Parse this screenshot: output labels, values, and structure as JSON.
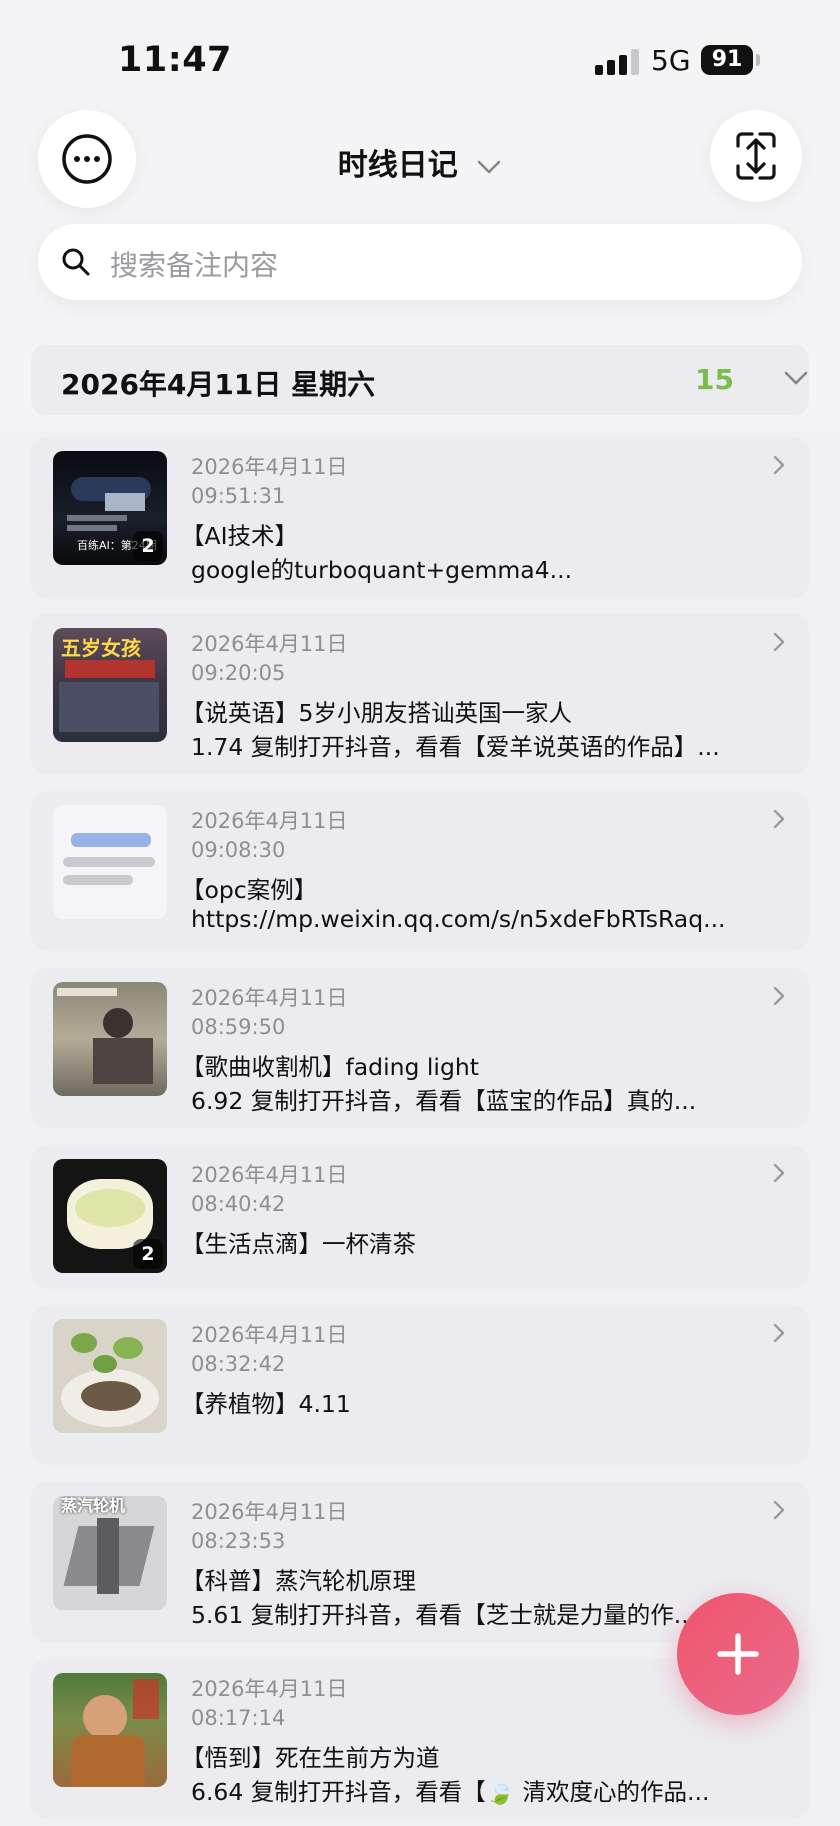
{
  "status_bar": {
    "time": "11:47",
    "network": "5G",
    "battery": "91"
  },
  "header": {
    "title": "时线日记",
    "search_placeholder": "搜索备注内容"
  },
  "date_group": {
    "date": "2026年4月11日 星期六",
    "count": "15"
  },
  "entries": [
    {
      "date": "2026年4月11日",
      "time": "09:51:31",
      "line1": "【AI技术】",
      "line2": "google的turboquant+gemma4...",
      "badge": "2",
      "thumb_caption": "百练AI：第24期"
    },
    {
      "date": "2026年4月11日",
      "time": "09:20:05",
      "line1": "【说英语】5岁小朋友搭讪英国一家人",
      "line2": "1.74 复制打开抖音，看看【爱羊说英语的作品】...",
      "badge": "",
      "thumb_caption": "五岁女孩"
    },
    {
      "date": "2026年4月11日",
      "time": "09:08:30",
      "line1": "【opc案例】",
      "line2": "https://mp.weixin.qq.com/s/n5xdeFbRTsRaq...",
      "badge": "",
      "thumb_caption": ""
    },
    {
      "date": "2026年4月11日",
      "time": "08:59:50",
      "line1": "【歌曲收割机】fading light",
      "line2": "6.92 复制打开抖音，看看【蓝宝的作品】真的...",
      "badge": "",
      "thumb_caption": ""
    },
    {
      "date": "2026年4月11日",
      "time": "08:40:42",
      "line1": "【生活点滴】一杯清茶",
      "line2": "",
      "badge": "2",
      "thumb_caption": ""
    },
    {
      "date": "2026年4月11日",
      "time": "08:32:42",
      "line1": "【养植物】4.11",
      "line2": "",
      "badge": "",
      "thumb_caption": ""
    },
    {
      "date": "2026年4月11日",
      "time": "08:23:53",
      "line1": "【科普】蒸汽轮机原理",
      "line2": "5.61 复制打开抖音，看看【芝士就是力量的作...",
      "badge": "",
      "thumb_caption": "蒸汽轮机"
    },
    {
      "date": "2026年4月11日",
      "time": "08:17:14",
      "line1": "【悟到】死在生前方为道",
      "line2": "6.64 复制打开抖音，看看【🍃 清欢度心的作品...",
      "badge": "",
      "thumb_caption": ""
    }
  ],
  "colors": {
    "accent_green": "#7bbd4a",
    "fab": "#ee5a72",
    "background": "#efeff4"
  },
  "icons": {
    "more": "more-icon",
    "sync": "sync-icon",
    "search": "search-icon",
    "add": "plus-icon"
  }
}
